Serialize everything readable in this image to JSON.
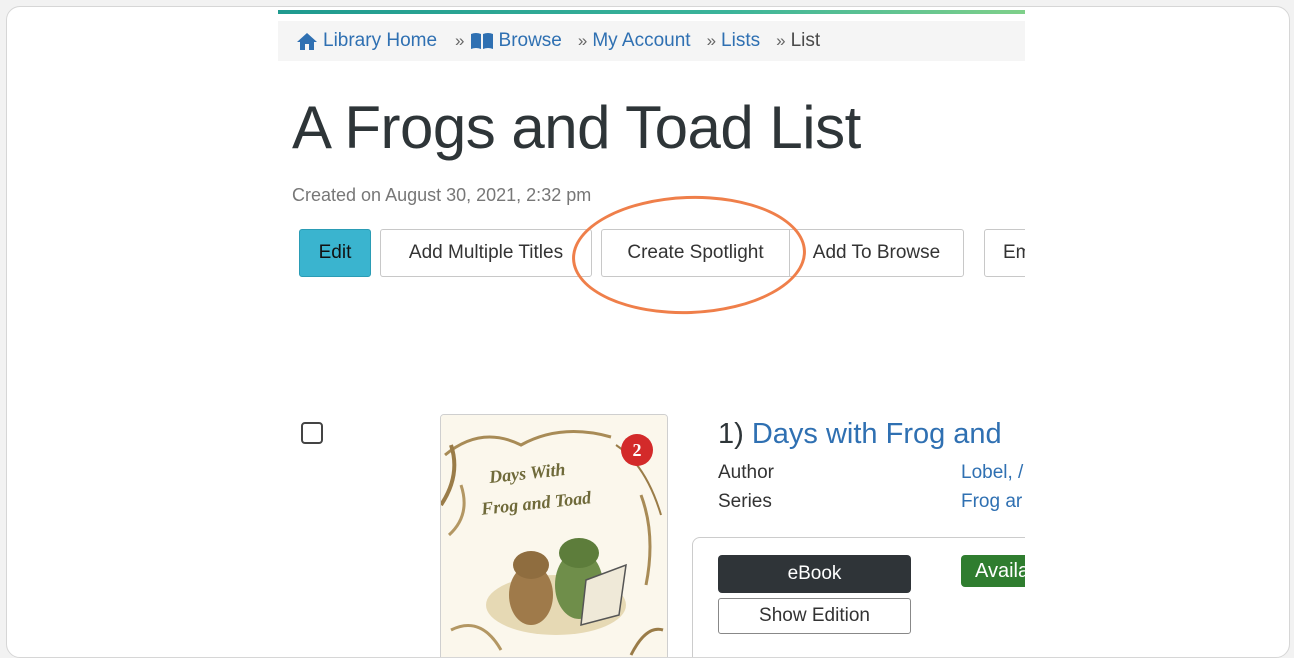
{
  "breadcrumb": {
    "home": "Library Home",
    "browse": "Browse",
    "account": "My Account",
    "lists": "Lists",
    "current": "List",
    "separator": "»"
  },
  "page": {
    "title": "A Frogs and Toad List",
    "created": "Created on August 30, 2021, 2:32 pm"
  },
  "toolbar": {
    "edit": "Edit",
    "add_multiple": "Add Multiple Titles",
    "create_spotlight": "Create Spotlight",
    "add_to_browse": "Add To Browse",
    "email": "Em"
  },
  "results": [
    {
      "number": "1)",
      "title": "Days with Frog and",
      "author_label": "Author",
      "author_value": "Lobel, /",
      "series_label": "Series",
      "series_value": "Frog ar",
      "format": "eBook",
      "show_edition": "Show Edition",
      "status": "Availa",
      "cover": {
        "title_line1": "Days With",
        "title_line2": "Frog and Toad",
        "level_badge": "2"
      }
    }
  ],
  "colors": {
    "accent": "#3ab4cf",
    "link": "#2f70b2",
    "highlight_circle": "#ef7f4a",
    "available": "#2f7d2f"
  }
}
